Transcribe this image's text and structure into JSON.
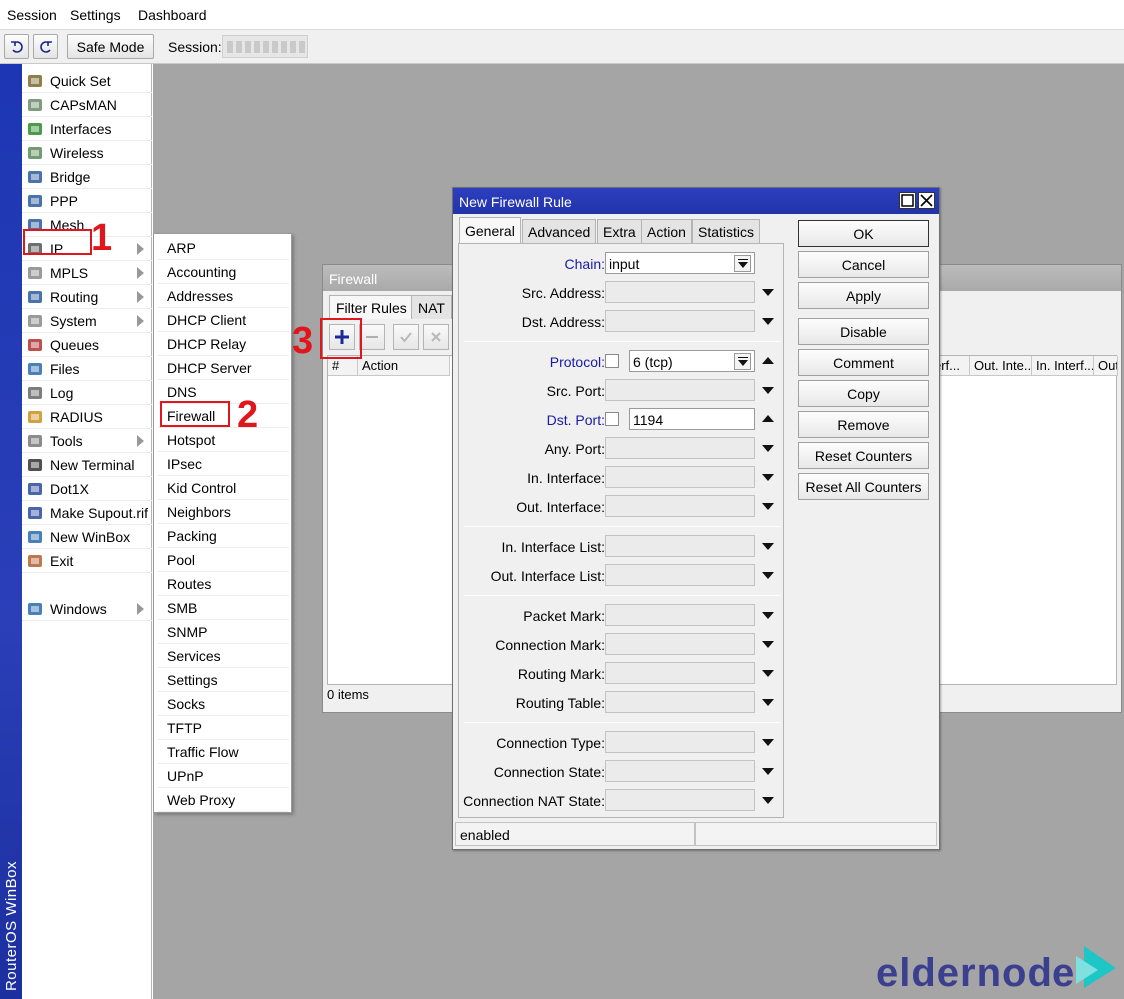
{
  "menubar": {
    "items": [
      "Session",
      "Settings",
      "Dashboard"
    ]
  },
  "toolbar": {
    "safe_mode": "Safe Mode",
    "session_label": "Session:"
  },
  "brand": "RouterOS WinBox",
  "sidebar": {
    "items": [
      {
        "label": "Quick Set",
        "icon": "wand-icon",
        "arrow": false
      },
      {
        "label": "CAPsMAN",
        "icon": "antenna-icon",
        "arrow": false
      },
      {
        "label": "Interfaces",
        "icon": "interfaces-icon",
        "arrow": false
      },
      {
        "label": "Wireless",
        "icon": "wireless-icon",
        "arrow": false
      },
      {
        "label": "Bridge",
        "icon": "bridge-icon",
        "arrow": false
      },
      {
        "label": "PPP",
        "icon": "ppp-icon",
        "arrow": false
      },
      {
        "label": "Mesh",
        "icon": "mesh-icon",
        "arrow": false
      },
      {
        "label": "IP",
        "icon": "ip-icon",
        "arrow": true
      },
      {
        "label": "MPLS",
        "icon": "mpls-icon",
        "arrow": true
      },
      {
        "label": "Routing",
        "icon": "routing-icon",
        "arrow": true
      },
      {
        "label": "System",
        "icon": "gear-icon",
        "arrow": true
      },
      {
        "label": "Queues",
        "icon": "queues-icon",
        "arrow": false
      },
      {
        "label": "Files",
        "icon": "folder-icon",
        "arrow": false
      },
      {
        "label": "Log",
        "icon": "log-icon",
        "arrow": false
      },
      {
        "label": "RADIUS",
        "icon": "users-icon",
        "arrow": false
      },
      {
        "label": "Tools",
        "icon": "tools-icon",
        "arrow": true
      },
      {
        "label": "New Terminal",
        "icon": "terminal-icon",
        "arrow": false
      },
      {
        "label": "Dot1X",
        "icon": "dot1x-icon",
        "arrow": false
      },
      {
        "label": "Make Supout.rif",
        "icon": "supout-icon",
        "arrow": false
      },
      {
        "label": "New WinBox",
        "icon": "winbox-icon",
        "arrow": false
      },
      {
        "label": "Exit",
        "icon": "exit-icon",
        "arrow": false
      },
      {
        "label": "Windows",
        "icon": "windows-icon",
        "arrow": true
      }
    ]
  },
  "ip_submenu": {
    "items": [
      "ARP",
      "Accounting",
      "Addresses",
      "DHCP Client",
      "DHCP Relay",
      "DHCP Server",
      "DNS",
      "Firewall",
      "Hotspot",
      "IPsec",
      "Kid Control",
      "Neighbors",
      "Packing",
      "Pool",
      "Routes",
      "SMB",
      "SNMP",
      "Services",
      "Settings",
      "Socks",
      "TFTP",
      "Traffic Flow",
      "UPnP",
      "Web Proxy"
    ]
  },
  "firewall": {
    "title": "Firewall",
    "tabs": [
      "Filter Rules",
      "NAT"
    ],
    "columns": [
      "#",
      "Action",
      "erf...",
      "Out. Inte...",
      "In. Interf...",
      "Out. I"
    ],
    "status": "0 items"
  },
  "dialog": {
    "title": "New Firewall Rule",
    "tabs": [
      "General",
      "Advanced",
      "Extra",
      "Action",
      "Statistics"
    ],
    "fields": {
      "chain": {
        "label": "Chain:",
        "value": "input"
      },
      "src_address": {
        "label": "Src. Address:"
      },
      "dst_address": {
        "label": "Dst. Address:"
      },
      "protocol": {
        "label": "Protocol:",
        "value": "6 (tcp)"
      },
      "src_port": {
        "label": "Src. Port:"
      },
      "dst_port": {
        "label": "Dst. Port:",
        "value": "1194"
      },
      "any_port": {
        "label": "Any. Port:"
      },
      "in_interface": {
        "label": "In. Interface:"
      },
      "out_interface": {
        "label": "Out. Interface:"
      },
      "in_interface_list": {
        "label": "In. Interface List:"
      },
      "out_interface_list": {
        "label": "Out. Interface List:"
      },
      "packet_mark": {
        "label": "Packet Mark:"
      },
      "connection_mark": {
        "label": "Connection Mark:"
      },
      "routing_mark": {
        "label": "Routing Mark:"
      },
      "routing_table": {
        "label": "Routing Table:"
      },
      "connection_type": {
        "label": "Connection Type:"
      },
      "connection_state": {
        "label": "Connection State:"
      },
      "connection_nat_state": {
        "label": "Connection NAT State:"
      }
    },
    "buttons": [
      "OK",
      "Cancel",
      "Apply",
      "Disable",
      "Comment",
      "Copy",
      "Remove",
      "Reset Counters",
      "Reset All Counters"
    ],
    "status": "enabled"
  },
  "annotations": [
    "1",
    "2",
    "3"
  ],
  "watermark": {
    "text": "eldernode",
    "colors": {
      "dark": "#3a3f8f",
      "accent": "#1ec6c6"
    }
  },
  "colors": {
    "title_active": "#2233a8",
    "annotation": "#e0161c",
    "link_label": "#1a1aa6"
  }
}
